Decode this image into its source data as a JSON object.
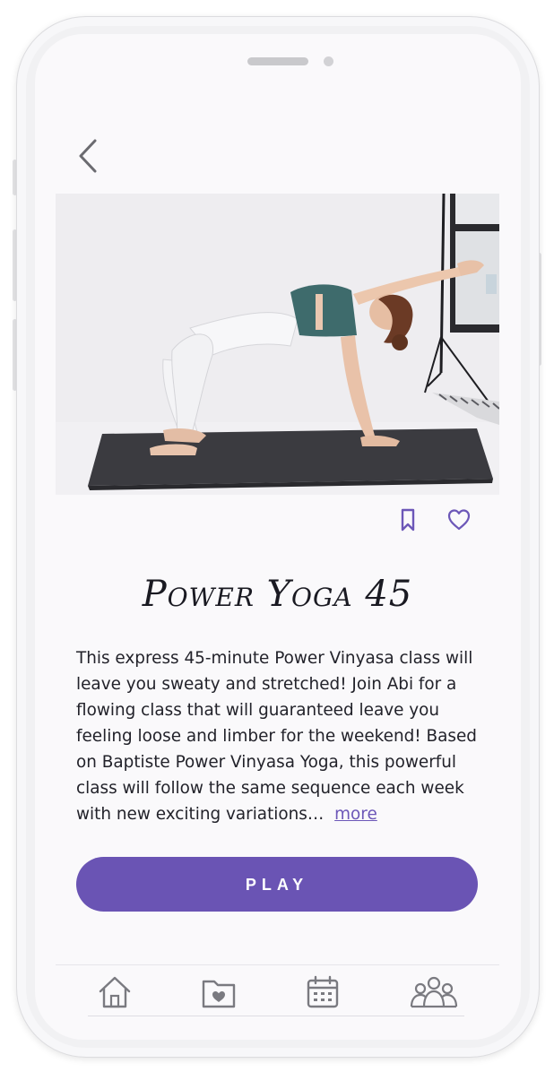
{
  "nav": {
    "back_icon": "chevron-left-icon"
  },
  "hero": {
    "image_description": ""
  },
  "actions": {
    "bookmark_icon": "bookmark-icon",
    "favorite_icon": "heart-icon"
  },
  "content": {
    "title": "Power Yoga 45",
    "description": "This express 45-minute Power Vinyasa class will leave you sweaty and stretched! Join Abi for a flowing class that will guaranteed leave you feeling loose and limber for the weekend! Based on Baptiste Power Vinyasa Yoga, this powerful class will follow the same sequence each week with new exciting variations…",
    "more_label": "more"
  },
  "play": {
    "label": "PLAY"
  },
  "tabbar": {
    "items": [
      {
        "icon": "home-icon"
      },
      {
        "icon": "favorites-folder-icon"
      },
      {
        "icon": "calendar-icon"
      },
      {
        "icon": "community-icon"
      }
    ]
  },
  "colors": {
    "accent": "#6a54b4",
    "icon": "#6c57b8",
    "tab_icon": "#7a7a80",
    "text": "#22222a"
  }
}
